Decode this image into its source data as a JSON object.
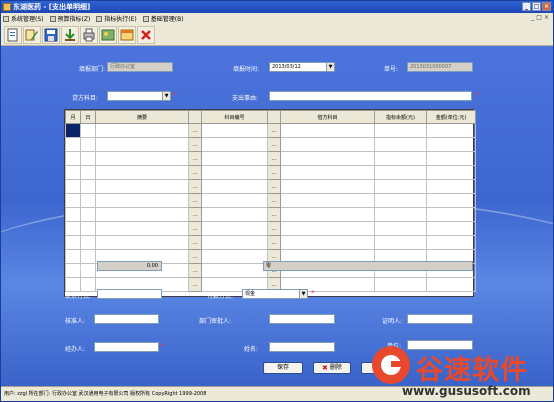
{
  "window": {
    "title": "东湖医药 - [支出单明细]",
    "buttons": [
      "_",
      "□",
      "×"
    ]
  },
  "menu": {
    "items": [
      "系统管理(S)",
      "预算指标(Z)",
      "指标执行(E)",
      "基础管理(B)"
    ],
    "mdi_buttons": [
      "_",
      "□",
      "×"
    ]
  },
  "toolbar": {
    "icons": [
      "new-doc-icon",
      "edit-icon",
      "save-icon",
      "import-icon",
      "print-icon",
      "preview-icon",
      "exit-icon",
      "delete-icon"
    ]
  },
  "form": {
    "dept_label": "填报部门:",
    "dept_value": "行政办公室",
    "date_label": "填报时间:",
    "date_value": "2013/03/12",
    "number_label": "单号:",
    "number_value": "2013031000007",
    "debit_label": "贷方科目:",
    "debit_value": "",
    "reason_label": "支出事由:",
    "reason_value": "",
    "required_mark": "*"
  },
  "grid": {
    "headers": [
      "月",
      "日",
      "摘要",
      "",
      "科目编号",
      "",
      "借方科目",
      "指标余额(元)",
      "金额(单位:元)"
    ],
    "button_label": "...",
    "row_count": 12
  },
  "totals": {
    "total_label": "总计:",
    "total_value": "0.00",
    "rmb_label": "人民币(大写):",
    "rmb_value": "零"
  },
  "contact": {
    "contact_label": "联系方式:",
    "contact_value": "",
    "payment_label": "付款方式:",
    "payment_value": "现金"
  },
  "approvals": {
    "handler_label": "核准人:",
    "dept_approver_label": "部门审批人:",
    "witness_label": "证明人:",
    "operator_label": "经办人:",
    "name_label": "姓名:",
    "unit_label": "单位:"
  },
  "actions": {
    "save_label": "保存",
    "delete_label": "删除",
    "print_label": "打印"
  },
  "status": {
    "text": "用户: zzgl 所在部门: 行政办公室 武汉通用电子有限公司 版权所有 CopyRight  1999-2008"
  },
  "watermark": {
    "text": "谷速软件",
    "url": "www.gususoft.com"
  }
}
